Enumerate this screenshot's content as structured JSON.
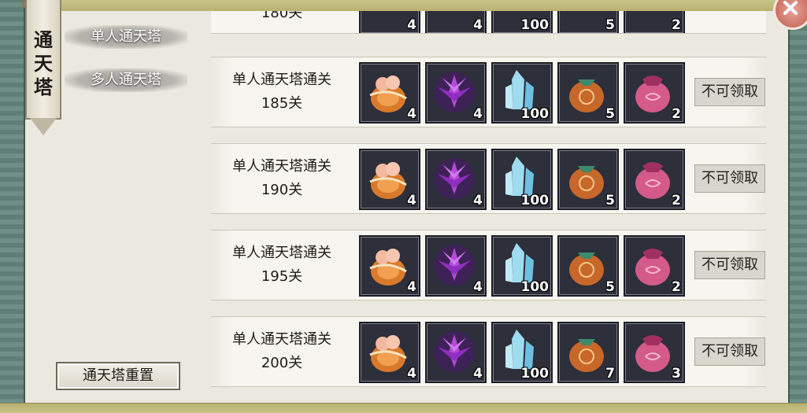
{
  "window": {
    "banner_title": "通天塔",
    "close_icon": "close-icon"
  },
  "tabs": [
    {
      "label": "单人通天塔"
    },
    {
      "label": "多人通天塔"
    }
  ],
  "reset_button": {
    "label": "通天塔重置"
  },
  "claim_label": "不可领取",
  "top_partial_row": {
    "title_line2": "180关",
    "counts": [
      "4",
      "4",
      "100",
      "5",
      "2"
    ]
  },
  "rows": [
    {
      "title_line1": "单人通天塔通关",
      "title_line2": "185关",
      "items": [
        {
          "icon": "orange-gourd-icon",
          "count": "4"
        },
        {
          "icon": "purple-lotus-icon",
          "count": "4"
        },
        {
          "icon": "blue-crystal-icon",
          "count": "100"
        },
        {
          "icon": "orange-pouch-icon",
          "count": "5"
        },
        {
          "icon": "pink-pouch-icon",
          "count": "2"
        }
      ],
      "claim": "不可领取"
    },
    {
      "title_line1": "单人通天塔通关",
      "title_line2": "190关",
      "items": [
        {
          "icon": "orange-gourd-icon",
          "count": "4"
        },
        {
          "icon": "purple-lotus-icon",
          "count": "4"
        },
        {
          "icon": "blue-crystal-icon",
          "count": "100"
        },
        {
          "icon": "orange-pouch-icon",
          "count": "5"
        },
        {
          "icon": "pink-pouch-icon",
          "count": "2"
        }
      ],
      "claim": "不可领取"
    },
    {
      "title_line1": "单人通天塔通关",
      "title_line2": "195关",
      "items": [
        {
          "icon": "orange-gourd-icon",
          "count": "4"
        },
        {
          "icon": "purple-lotus-icon",
          "count": "4"
        },
        {
          "icon": "blue-crystal-icon",
          "count": "100"
        },
        {
          "icon": "orange-pouch-icon",
          "count": "5"
        },
        {
          "icon": "pink-pouch-icon",
          "count": "2"
        }
      ],
      "claim": "不可领取"
    },
    {
      "title_line1": "单人通天塔通关",
      "title_line2": "200关",
      "items": [
        {
          "icon": "orange-gourd-icon",
          "count": "4"
        },
        {
          "icon": "purple-lotus-icon",
          "count": "4"
        },
        {
          "icon": "blue-crystal-icon",
          "count": "100"
        },
        {
          "icon": "orange-pouch-icon",
          "count": "7"
        },
        {
          "icon": "pink-pouch-icon",
          "count": "3"
        }
      ],
      "claim": "不可领取"
    }
  ],
  "colors": {
    "frame_jade": "#6f8f86",
    "paper": "#ebe8df",
    "item_bg": "#2d2f3a",
    "close_red": "#c05a4a"
  }
}
